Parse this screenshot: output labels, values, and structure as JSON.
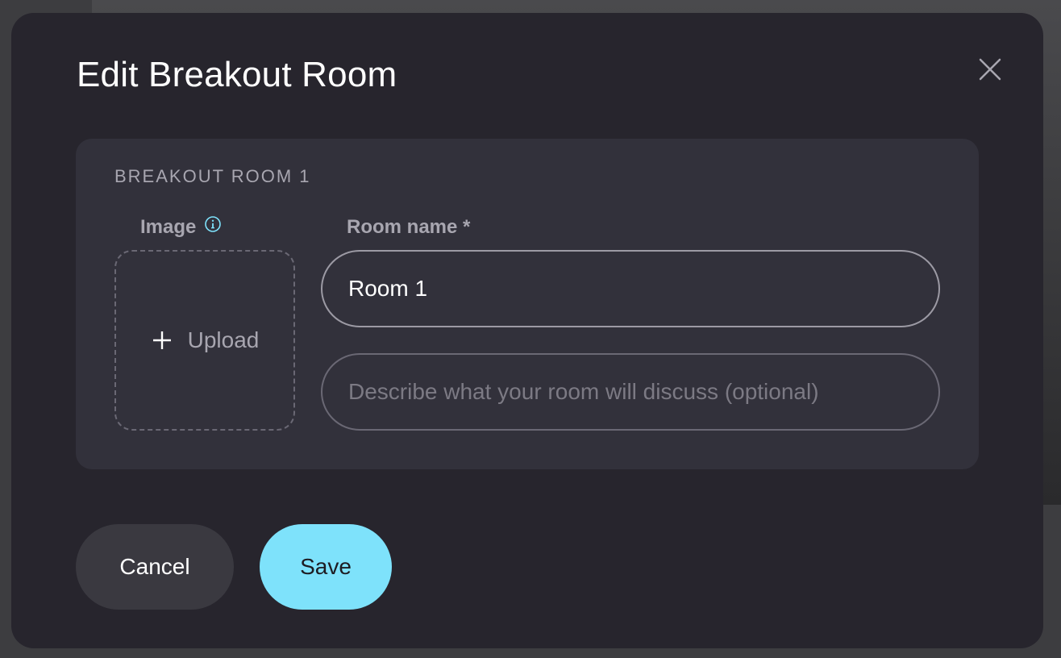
{
  "dialog": {
    "title": "Edit Breakout Room",
    "close_icon": "close-icon"
  },
  "room": {
    "heading": "BREAKOUT ROOM 1",
    "image_label": "Image",
    "info_icon": "info-icon",
    "upload_label": "Upload",
    "upload_icon": "plus-icon",
    "name_label": "Room name *",
    "name_value": "Room 1",
    "description_value": "",
    "description_placeholder": "Describe what your room will discuss (optional)"
  },
  "actions": {
    "cancel_label": "Cancel",
    "save_label": "Save"
  },
  "colors": {
    "accent": "#7ee2fb",
    "modal_bg": "#27252d",
    "card_bg": "#32313b"
  }
}
